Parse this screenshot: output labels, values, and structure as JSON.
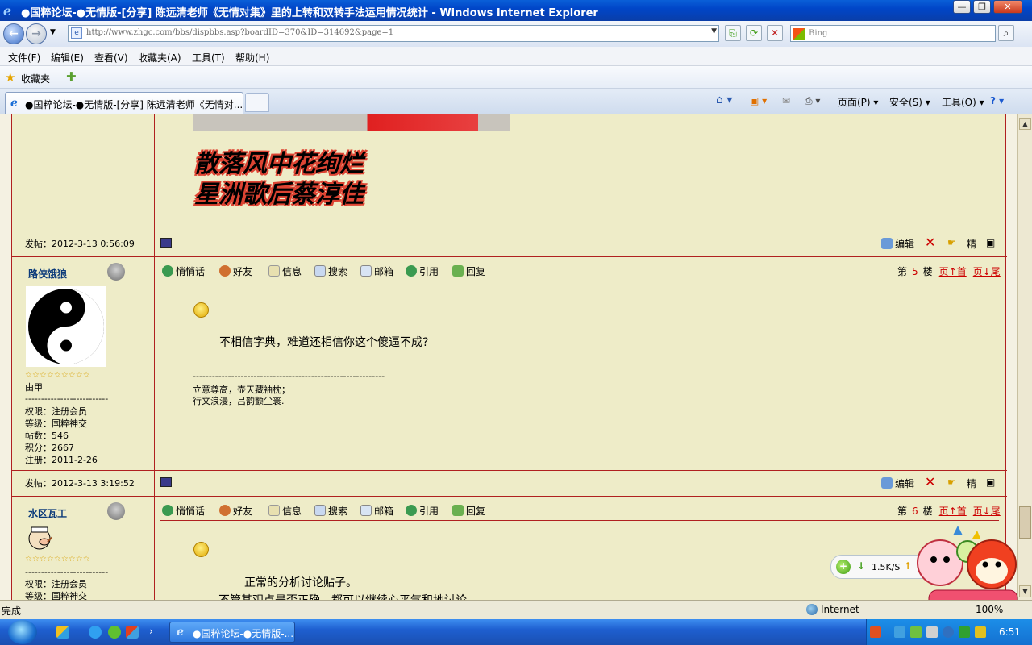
{
  "window": {
    "title": "●国粹论坛-●无情版-[分享] 陈远清老师《无情对集》里的上转和双转手法运用情况统计 - Windows Internet Explorer",
    "controls": [
      "—",
      "❐",
      "✕"
    ]
  },
  "address": {
    "url": "http://www.zhgc.com/bbs/dispbbs.asp?boardID=370&ID=314692&page=1",
    "search_placeholder": "Bing"
  },
  "menu": [
    "文件(F)",
    "编辑(E)",
    "查看(V)",
    "收藏夹(A)",
    "工具(T)",
    "帮助(H)"
  ],
  "favorites": {
    "label": "收藏夹"
  },
  "tabs": [
    {
      "label": "●国粹论坛-●无情版-[分享] 陈远清老师《无情对..."
    }
  ],
  "command_bar": {
    "page": "页面(P)",
    "safety": "安全(S)",
    "tools": "工具(O)"
  },
  "page": {
    "headline": [
      "散落风中花绚烂",
      "星洲歌后蔡淳佳"
    ],
    "posts": [
      {
        "meta": "发帖：2012-3-13 0:56:09",
        "tools": [
          "编辑",
          "精"
        ]
      },
      {
        "user": "路侠饿狼",
        "stars": "☆☆☆☆☆☆☆☆☆",
        "title": "由甲",
        "separator": "--------------------------",
        "info": [
          "权限：注册会员",
          "等级：国粹神交",
          "帖数：546",
          "积分：2667",
          "注册：2011-2-26"
        ],
        "actions": [
          "悄悄话",
          "好友",
          "信息",
          "搜索",
          "邮箱",
          "引用",
          "回复"
        ],
        "floor_prefix": "第",
        "floor": "5",
        "floor_suffix": "楼",
        "nav_top": "页↑首",
        "nav_bottom": "页↓尾",
        "content": "不相信字典，难道还相信你这个傻逼不成?",
        "signature_rule": "------------------------------------------------------------",
        "signature": [
          "立意尊高，壶天藏袖枕；",
          "行文浪漫，吕韵颤尘寰."
        ],
        "footer_meta": "发帖：2012-3-13 3:19:52",
        "footer_tools": [
          "编辑",
          "精"
        ]
      },
      {
        "user": "水区瓦工",
        "stars": "☆☆☆☆☆☆☆☆☆",
        "separator": "--------------------------",
        "info": [
          "权限：注册会员",
          "等级：国粹神交"
        ],
        "actions": [
          "悄悄话",
          "好友",
          "信息",
          "搜索",
          "邮箱",
          "引用",
          "回复"
        ],
        "floor_prefix": "第",
        "floor": "6",
        "floor_suffix": "楼",
        "nav_top": "页↑首",
        "nav_bottom": "页↓尾",
        "content": [
          "正常的分析讨论贴子。",
          "不管其观点是否正确，都可以继续心平气和地讨论。"
        ]
      }
    ]
  },
  "status": {
    "text": "完成",
    "zone": "Internet",
    "zoom": "100%"
  },
  "speed_widget": {
    "rate": "1.5K/S"
  },
  "taskbar": {
    "button": "●国粹论坛-●无情版-...",
    "clock": "6:51"
  },
  "colors": {
    "forum_border": "#b02020",
    "forum_bg": "#eeecc8",
    "titlebar": "#0046c8"
  }
}
